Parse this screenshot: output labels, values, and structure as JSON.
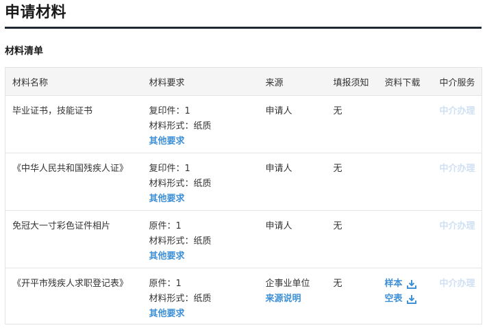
{
  "page_title": "申请材料",
  "section_title": "材料清单",
  "table": {
    "headers": {
      "name": "材料名称",
      "requirement": "材料要求",
      "source": "来源",
      "fill_notice": "填报须知",
      "download": "资料下载",
      "agency": "中介服务"
    },
    "rows": [
      {
        "name": "毕业证书，技能证书",
        "copy": "复印件：1",
        "form": "材料形式：纸质",
        "other": "其他要求",
        "source": "申请人",
        "notice": "无",
        "agency": "中介办理"
      },
      {
        "name": "《中华人民共和国残疾人证》",
        "copy": "复印件：1",
        "form": "材料形式：纸质",
        "other": "其他要求",
        "source": "申请人",
        "notice": "无",
        "agency": "中介办理"
      },
      {
        "name": "免冠大一寸彩色证件相片",
        "copy": "原件：1",
        "form": "材料形式：纸质",
        "other": "其他要求",
        "source": "申请人",
        "notice": "无",
        "agency": "中介办理"
      },
      {
        "name": "《开平市残疾人求职登记表》",
        "copy": "原件：1",
        "form": "材料形式：纸质",
        "other": "其他要求",
        "source": "企事业单位",
        "source_link": "来源说明",
        "notice": "无",
        "download_sample": "样本",
        "download_blank": "空表",
        "agency": "中介办理"
      }
    ]
  },
  "colors": {
    "link": "#3d8fd6",
    "agency_disabled": "#cfe0f3",
    "header_bg": "#f5f5f5",
    "title_rule": "#1f2733"
  },
  "icons": {
    "download": "download-icon"
  }
}
